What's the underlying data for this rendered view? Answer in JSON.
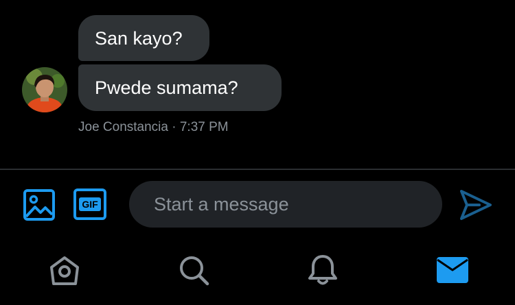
{
  "conversation": {
    "messages": [
      {
        "text": "San kayo?"
      },
      {
        "text": "Pwede sumama?"
      }
    ],
    "meta": "Joe Constancia · 7:37 PM"
  },
  "composer": {
    "placeholder": "Start a message",
    "value": "",
    "media_icon": "image-icon",
    "gif_label": "GIF",
    "send_icon": "send-icon"
  },
  "bottom_nav": {
    "items": [
      "home-icon",
      "search-icon",
      "notifications-icon",
      "messages-icon"
    ],
    "active": "messages-icon"
  },
  "colors": {
    "background": "#000000",
    "bubble": "#2f3336",
    "accent": "#1d9bf0",
    "muted_text": "#8b9299",
    "input_bg": "#202327",
    "inactive_icon": "#8b9299"
  }
}
